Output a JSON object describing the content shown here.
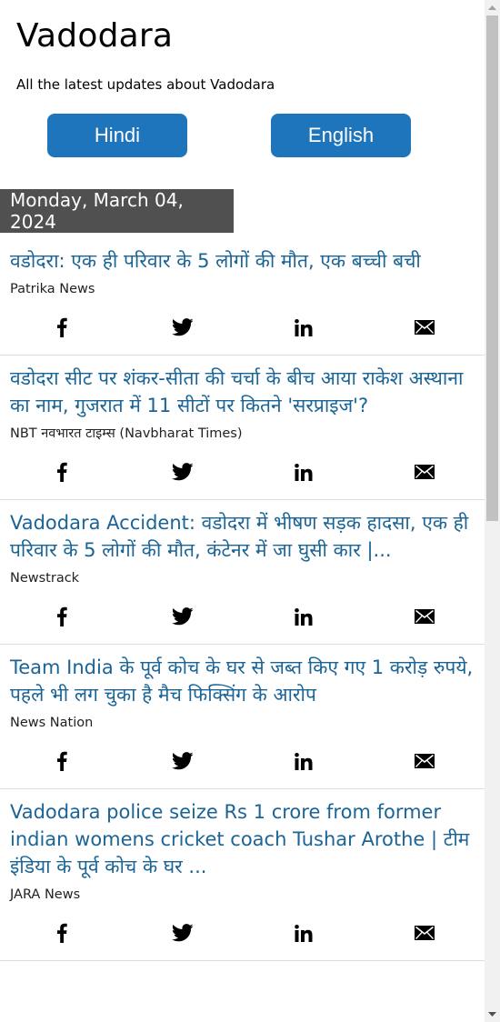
{
  "header": {
    "title": "Vadodara",
    "subtitle": "All the latest updates about Vadodara"
  },
  "language_buttons": {
    "hindi": "Hindi",
    "english": "English"
  },
  "date": "Monday, March 04, 2024",
  "colors": {
    "button_bg": "#1f75bb",
    "headline": "#1a6496",
    "date_bar_bg": "#505050"
  },
  "share_icons": [
    "facebook-icon",
    "twitter-icon",
    "linkedin-icon",
    "email-icon"
  ],
  "articles": [
    {
      "headline": "वडोदरा: एक ही परिवार के 5 लोगों की मौत, एक बच्ची बची",
      "source": "Patrika News"
    },
    {
      "headline": "वडोदरा सीट पर शंकर-सीता की चर्चा के बीच आया राकेश अस्थाना का नाम, गुजरात में 11 सीटों पर कितने 'सरप्राइज'?",
      "source": "NBT नवभारत टाइम्स (Navbharat Times)"
    },
    {
      "headline": "Vadodara Accident: वडोदरा में भीषण सड़क हादसा, एक ही परिवार के 5 लोगों की मौत, कंटेनर में जा घुसी कार |...",
      "source": "Newstrack"
    },
    {
      "headline": "Team India के पूर्व कोच के घर से जब्त किए गए 1 करोड़ रुपये, पहले भी लग चुका है मैच फिक्सिंग के आरोप",
      "source": "News Nation"
    },
    {
      "headline": "Vadodara police seize Rs 1 crore from former indian womens cricket coach Tushar Arothe | टीम इंडिया के पूर्व कोच के घर ...",
      "source": "JARA News"
    }
  ]
}
